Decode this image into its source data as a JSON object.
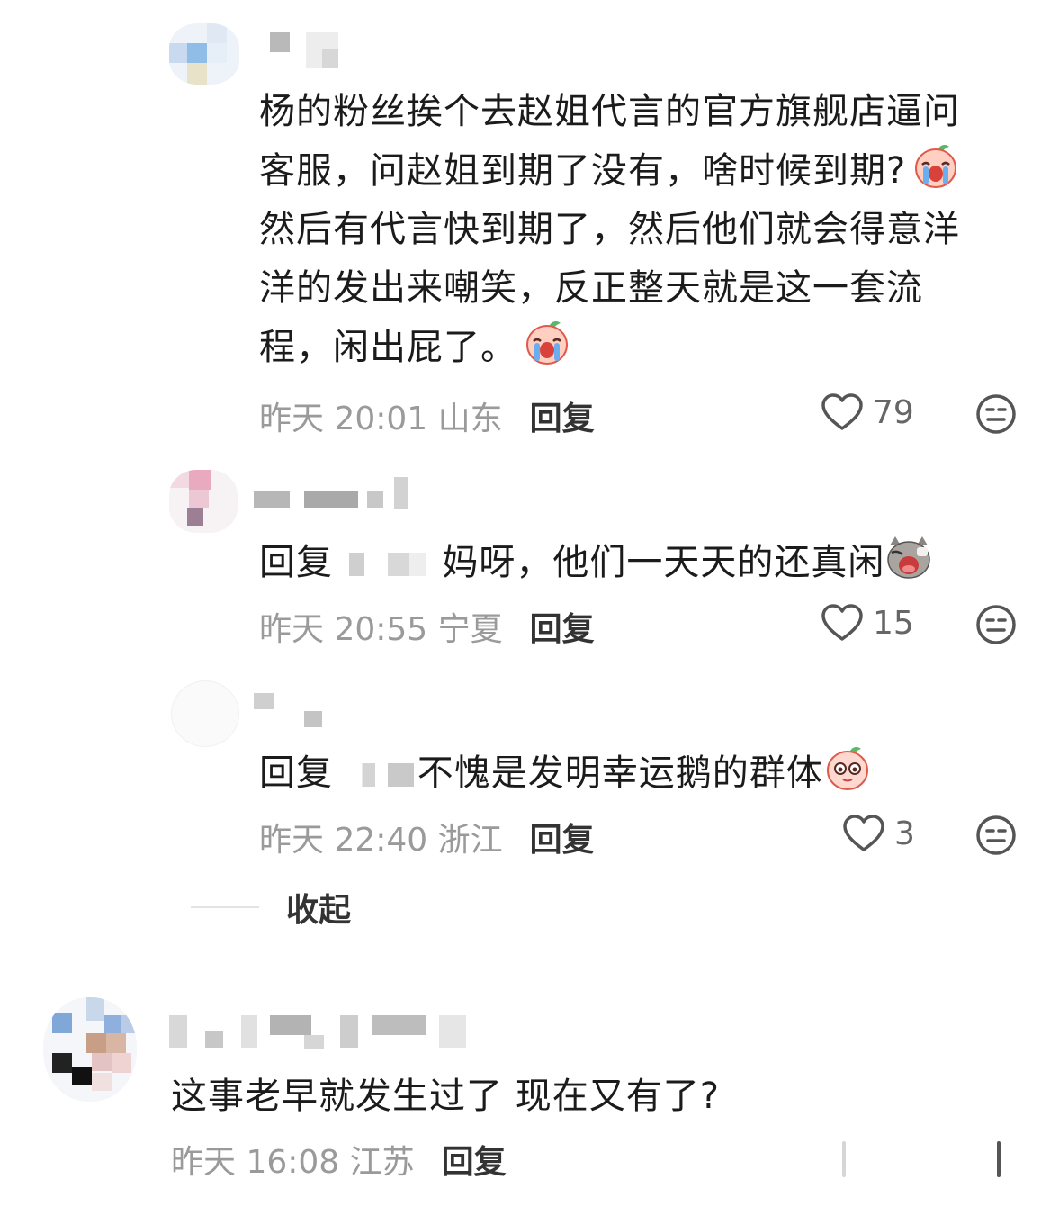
{
  "comments": [
    {
      "text_line1": "杨的粉丝挨个去赵姐代言的官方旗舰店逼问",
      "text_line2": "客服，问赵姐到期了没有，啥时候到期?",
      "text_line3": "然后有代言快到期了，然后他们就会得意洋",
      "text_line4": "洋的发出来嘲笑，反正整天就是这一套流",
      "text_line5": "程，闲出屁了。",
      "time": "昨天 20:01 山东",
      "reply_label": "回复",
      "likes": "79"
    },
    {
      "prefix": "回复",
      "text": "妈呀，他们一天天的还真闲",
      "time": "昨天 20:55 宁夏",
      "reply_label": "回复",
      "likes": "15"
    },
    {
      "prefix": "回复",
      "text": "不愧是发明幸运鹅的群体",
      "time": "昨天 22:40 浙江",
      "reply_label": "回复",
      "likes": "3"
    },
    {
      "text": "这事老早就发生过了 现在又有了?",
      "time": "昨天 16:08 江苏",
      "reply_label": "回复"
    }
  ],
  "collapse_label": "收起",
  "icons": {
    "like": "heart-outline-icon",
    "dislike": "meh-face-icon",
    "emoji_cry": "crying-peach-emoji",
    "emoji_cat": "yawning-cat-emoji",
    "emoji_peach": "teary-eyed-peach-emoji"
  },
  "colors": {
    "meta": "#9a9a9a",
    "text": "#1b1b1b"
  }
}
